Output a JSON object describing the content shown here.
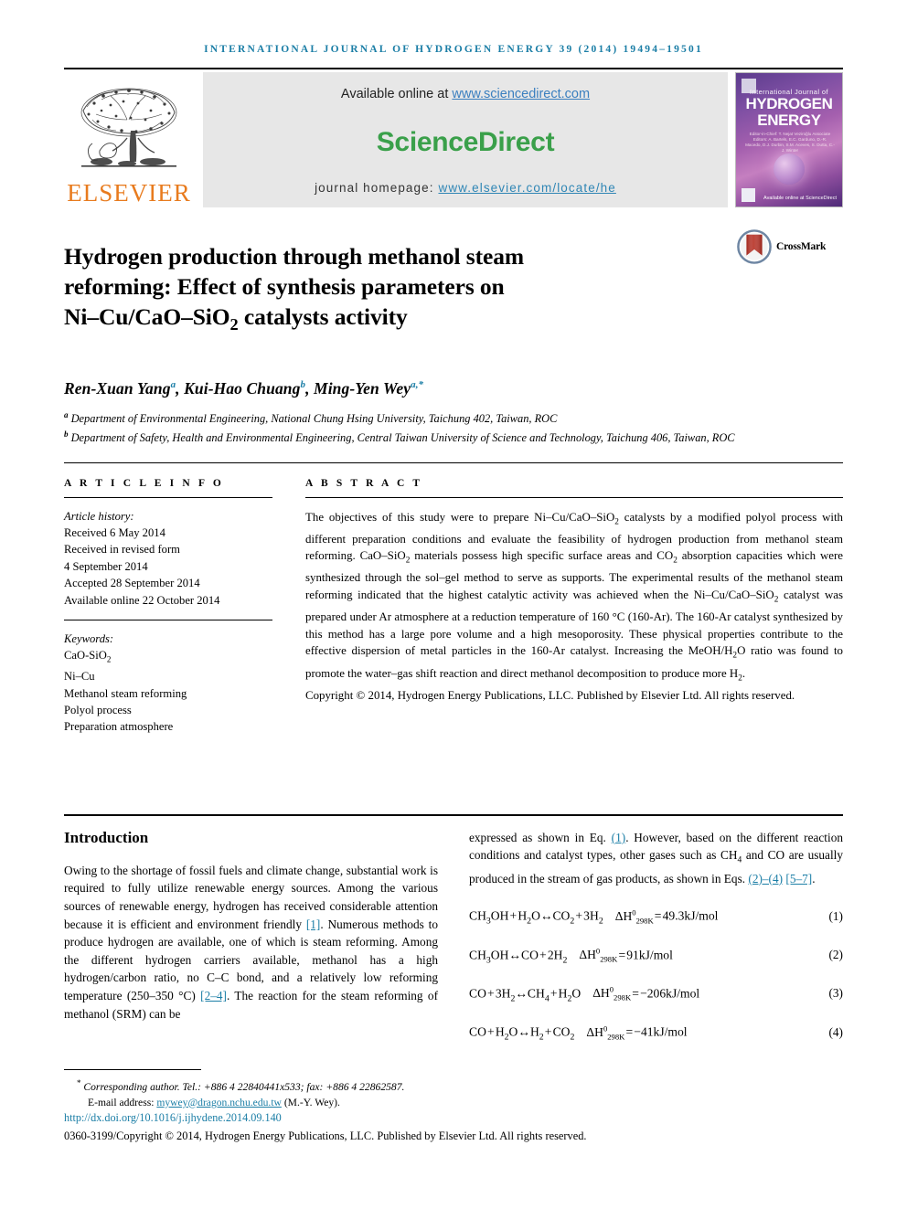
{
  "running_head": "International Journal of Hydrogen Energy 39 (2014) 19494–19501",
  "masthead": {
    "publisher_name": "ELSEVIER",
    "tree_logo_name": "elsevier-tree-logo",
    "available_prefix": "Available online at ",
    "available_link": "www.sciencedirect.com",
    "sciencedirect_wordmark": "ScienceDirect",
    "homepage_prefix": "journal homepage: ",
    "homepage_link": "www.elsevier.com/locate/he",
    "cover": {
      "line_small": "International Journal of",
      "line_big_1": "HYDROGEN",
      "line_big_2": "ENERGY",
      "editors_block": "Editor-in-Chief: T. Nejat Veziroğlu   Associate Editors: A. Bartels, E.C. Garduno, D.-R. Macedo, D.J. Durbin, S.M. Aceves, S. Dutta, C.-J. Winter",
      "science_direct_footer": "Available online at ScienceDirect"
    }
  },
  "article": {
    "title_line1": "Hydrogen production through methanol steam",
    "title_line2": "reforming: Effect of synthesis parameters on",
    "title_line3_pre": "Ni",
    "title_line3_dash1": "–",
    "title_line3_mid": "Cu/CaO",
    "title_line3_dash2": "–",
    "title_line3_post": "SiO",
    "title_line3_sub": "2",
    "title_line3_end": " catalysts activity",
    "crossmark_label": "CrossMark",
    "authors": [
      {
        "name": "Ren-Xuan Yang",
        "marks": "a",
        "sep": ", "
      },
      {
        "name": "Kui-Hao Chuang",
        "marks": "b",
        "sep": ", "
      },
      {
        "name": "Ming-Yen Wey",
        "marks": "a,*",
        "sep": ""
      }
    ],
    "affiliations": [
      {
        "mark": "a",
        "text": "Department of Environmental Engineering, National Chung Hsing University, Taichung 402, Taiwan, ROC"
      },
      {
        "mark": "b",
        "text": "Department of Safety, Health and Environmental Engineering, Central Taiwan University of Science and Technology, Taichung 406, Taiwan, ROC"
      }
    ]
  },
  "article_info": {
    "heading": "A R T I C L E   I N F O",
    "history_label": "Article history:",
    "history": [
      "Received 6 May 2014",
      "Received in revised form",
      "4 September 2014",
      "Accepted 28 September 2014",
      "Available online 22 October 2014"
    ],
    "keywords_label": "Keywords:",
    "keywords": [
      "CaO-SiO2",
      "Ni–Cu",
      "Methanol steam reforming",
      "Polyol process",
      "Preparation atmosphere"
    ]
  },
  "abstract": {
    "heading": "A B S T R A C T",
    "body": "The objectives of this study were to prepare Ni–Cu/CaO–SiO2 catalysts by a modified polyol process with different preparation conditions and evaluate the feasibility of hydrogen production from methanol steam reforming. CaO–SiO2 materials possess high specific surface areas and CO2 absorption capacities which were synthesized through the sol–gel method to serve as supports. The experimental results of the methanol steam reforming indicated that the highest catalytic activity was achieved when the Ni–Cu/CaO–SiO2 catalyst was prepared under Ar atmosphere at a reduction temperature of 160 °C (160-Ar). The 160-Ar catalyst synthesized by this method has a large pore volume and a high mesoporosity. These physical properties contribute to the effective dispersion of metal particles in the 160-Ar catalyst. Increasing the MeOH/H2O ratio was found to promote the water–gas shift reaction and direct methanol decomposition to produce more H2.",
    "copyright": "Copyright © 2014, Hydrogen Energy Publications, LLC. Published by Elsevier Ltd. All rights reserved."
  },
  "introduction": {
    "heading": "Introduction",
    "left_paragraph_parts": [
      "Owing to the shortage of fossil fuels and climate change, substantial work is required to fully utilize renewable energy sources. Among the various sources of renewable energy, hydrogen has received considerable attention because it is efficient and environment friendly ",
      "[1]",
      ". Numerous methods to produce hydrogen are available, one of which is steam reforming. Among the different hydrogen carriers available, methanol has a high hydrogen/carbon ratio, no C–C bond, and a relatively low reforming temperature (250–350 °C) ",
      "[2–4]",
      ". The reaction for the steam reforming of methanol (SRM) can be"
    ],
    "right_paragraph_parts": [
      "expressed as shown in Eq. ",
      "(1)",
      ". However, based on the different reaction conditions and catalyst types, other gases such as CH4 and CO are usually produced in the stream of gas products, as shown in Eqs. ",
      "(2)–(4)",
      " ",
      "[5–7]",
      "."
    ],
    "equations": [
      {
        "number": "(1)",
        "reaction": "CH3OH + H2O ↔ CO2 + 3H2",
        "enthalpy_symbol": "ΔH",
        "enthalpy_sup": "0",
        "enthalpy_sub": "298K",
        "enthalpy_value": "= 49.3 kJ/mol"
      },
      {
        "number": "(2)",
        "reaction": "CH3OH ↔ CO + 2H2",
        "enthalpy_symbol": "ΔH",
        "enthalpy_sup": "0",
        "enthalpy_sub": "298K",
        "enthalpy_value": "= 91 kJ/mol"
      },
      {
        "number": "(3)",
        "reaction": "CO + 3H2 ↔ CH4 + H2O",
        "enthalpy_symbol": "ΔH",
        "enthalpy_sup": "0",
        "enthalpy_sub": "298K",
        "enthalpy_value": "= −206 kJ/mol"
      },
      {
        "number": "(4)",
        "reaction": "CO + H2O ↔ H2 + CO2",
        "enthalpy_symbol": "ΔH",
        "enthalpy_sup": "0",
        "enthalpy_sub": "298K",
        "enthalpy_value": "= −41 kJ/mol"
      }
    ]
  },
  "footer": {
    "corresponding_mark": "*",
    "corresponding_text": " Corresponding author. Tel.: +886 4 22840441x533; fax: +886 4 22862587.",
    "email_label": "E-mail address: ",
    "email": "mywey@dragon.nchu.edu.tw",
    "email_suffix": " (M.-Y. Wey).",
    "doi": "http://dx.doi.org/10.1016/j.ijhydene.2014.09.140",
    "issn_line": "0360-3199/Copyright © 2014, Hydrogen Energy Publications, LLC. Published by Elsevier Ltd. All rights reserved."
  },
  "colors": {
    "link": "#1b7ea6",
    "elsevier_orange": "#e87b1e",
    "sciencedirect_green": "#3aa04a",
    "sd_link_blue": "#3a7fbf"
  }
}
